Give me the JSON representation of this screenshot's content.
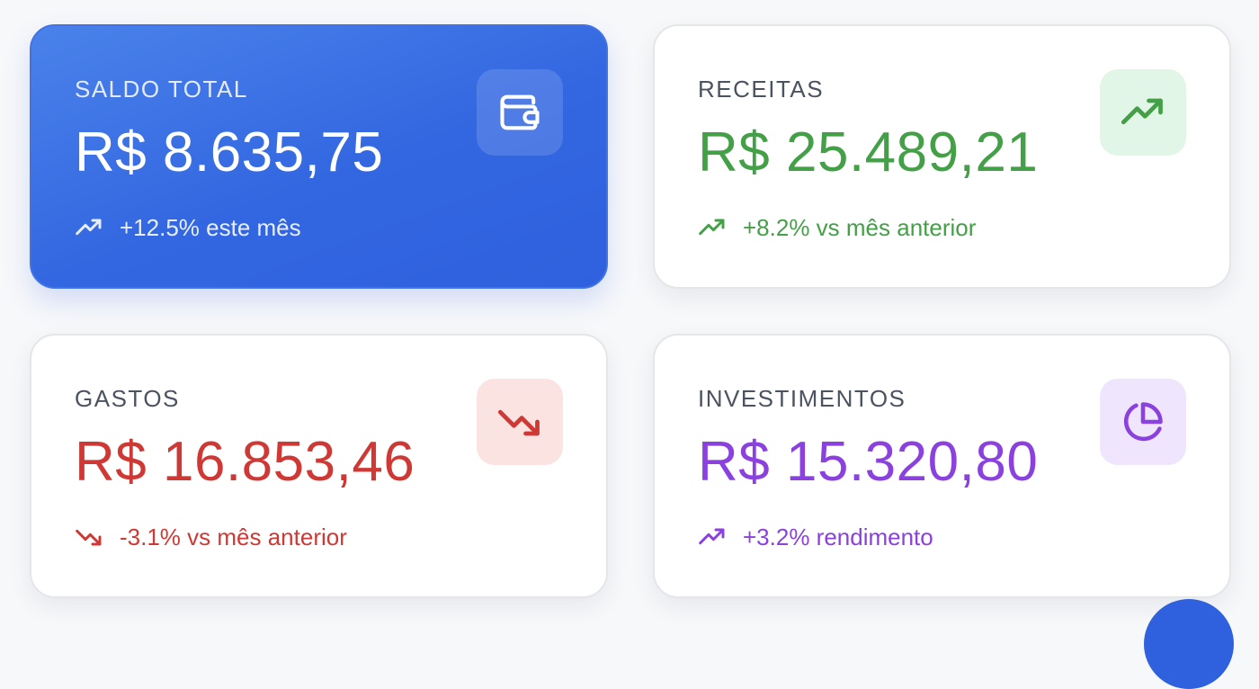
{
  "cards": [
    {
      "label": "SALDO TOTAL",
      "value": "R$ 8.635,75",
      "trend": "+12.5% este mês",
      "trend_direction": "up",
      "icon": "wallet-icon",
      "color": "#3367e1"
    },
    {
      "label": "RECEITAS",
      "value": "R$ 25.489,21",
      "trend": "+8.2% vs mês anterior",
      "trend_direction": "up",
      "icon": "trending-up-icon",
      "color": "#43a047"
    },
    {
      "label": "GASTOS",
      "value": "R$ 16.853,46",
      "trend": "-3.1% vs mês anterior",
      "trend_direction": "down",
      "icon": "trending-down-icon",
      "color": "#cf3935"
    },
    {
      "label": "INVESTIMENTOS",
      "value": "R$ 15.320,80",
      "trend": "+3.2% rendimento",
      "trend_direction": "up",
      "icon": "pie-chart-icon",
      "color": "#8a41dd"
    }
  ],
  "fab": {
    "icon": "add-icon",
    "color": "#2f60de"
  }
}
